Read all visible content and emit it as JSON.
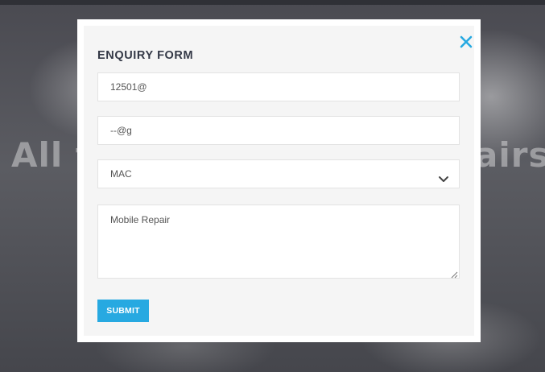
{
  "background": {
    "hero_title_left": "All t",
    "hero_title_right": "airs"
  },
  "modal": {
    "title": "ENQUIRY FORM",
    "close_icon": "close-icon",
    "fields": {
      "field1_value": "12501@",
      "field2_value": "--@g",
      "select_value": "MAC",
      "message_value": "Mobile Repair"
    },
    "submit_label": "SUBMIT"
  },
  "colors": {
    "accent": "#27a9e1",
    "title": "#333846"
  }
}
